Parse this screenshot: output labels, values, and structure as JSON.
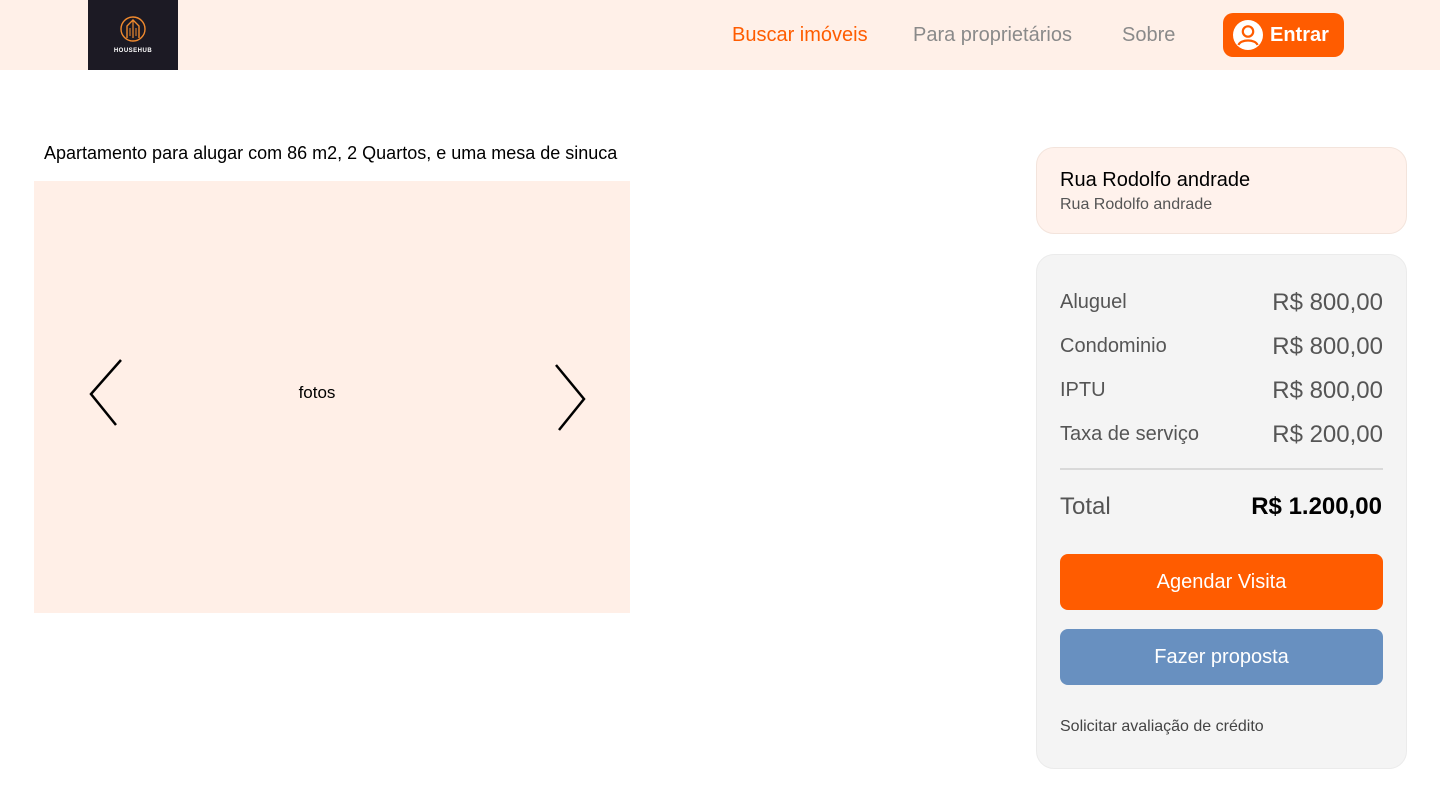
{
  "header": {
    "logo_text": "HOUSEHUB",
    "nav": {
      "buscar": "Buscar imóveis",
      "proprietarios": "Para proprietários",
      "sobre": "Sobre"
    },
    "login_label": "Entrar",
    "colors": {
      "background": "#fff0e8",
      "accent": "#ff5c00",
      "logo_bg": "#1c1a24"
    }
  },
  "listing": {
    "title": "Apartamento para alugar com 86 m2, 2 Quartos, e uma mesa de sinuca",
    "gallery_label": "fotos"
  },
  "address": {
    "title": "Rua Rodolfo andrade",
    "subtitle": "Rua Rodolfo andrade"
  },
  "pricing": {
    "rows": [
      {
        "label": "Aluguel",
        "value": "R$ 800,00"
      },
      {
        "label": "Condominio",
        "value": "R$ 800,00"
      },
      {
        "label": "IPTU",
        "value": "R$ 800,00"
      },
      {
        "label": "Taxa de serviço",
        "value": "R$ 200,00"
      }
    ],
    "total_label": "Total",
    "total_value": "R$ 1.200,00"
  },
  "actions": {
    "schedule_label": "Agendar Visita",
    "proposal_label": "Fazer proposta",
    "credit_label": "Solicitar avaliação de crédito"
  },
  "icons": {
    "logo": "building-icon",
    "login": "user-avatar-icon",
    "prev": "chevron-left-icon",
    "next": "chevron-right-icon"
  }
}
